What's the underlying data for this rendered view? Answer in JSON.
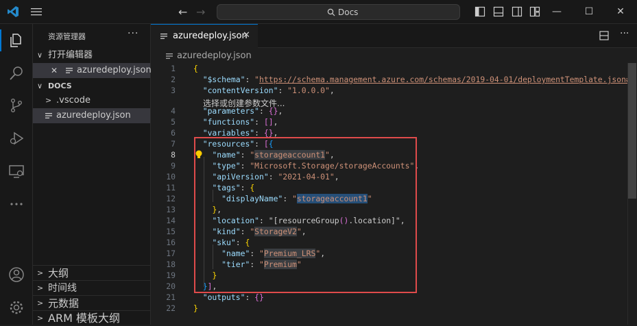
{
  "titlebar": {
    "search_text": "Docs",
    "back_icon": "arrow-left-icon",
    "forward_icon": "arrow-right-icon",
    "window_controls": [
      "minimize",
      "maximize",
      "close"
    ]
  },
  "activity_bar": {
    "icons": [
      "explorer-icon",
      "search-icon",
      "source-control-icon",
      "run-debug-icon",
      "remote-explorer-icon",
      "more-icon",
      "account-icon",
      "settings-gear-icon"
    ]
  },
  "sidebar": {
    "title": "资源管理器",
    "open_editors_label": "打开编辑器",
    "open_editor_file": "azuredeploy.json",
    "docs_label": "DOCS",
    "vscode_folder": ".vscode",
    "docs_file": "azuredeploy.json",
    "bottom_sections": [
      "大纲",
      "时间线",
      "元数据",
      "ARM 模板大纲"
    ]
  },
  "tabs": [
    {
      "label": "azuredeploy.json",
      "active": true
    }
  ],
  "breadcrumb": "azuredeploy.json",
  "editor": {
    "hint_text": "选择或创建参数文件...",
    "current_line": 8,
    "lines": [
      "{",
      "  \"$schema\": \"https://schema.management.azure.com/schemas/2019-04-01/deploymentTemplate.json#\",",
      "  \"contentVersion\": \"1.0.0.0\",",
      "  \"parameters\": {},",
      "  \"functions\": [],",
      "  \"variables\": {},",
      "  \"resources\": [{",
      "    \"name\": \"storageaccount1\",",
      "    \"type\": \"Microsoft.Storage/storageAccounts\",",
      "    \"apiVersion\": \"2021-04-01\",",
      "    \"tags\": {",
      "      \"displayName\": \"storageaccount1\"",
      "    },",
      "    \"location\": \"[resourceGroup().location]\",",
      "    \"kind\": \"StorageV2\",",
      "    \"sku\": {",
      "      \"name\": \"Premium_LRS\",",
      "      \"tier\": \"Premium\"",
      "    }",
      "  }],",
      "  \"outputs\": {}",
      "}"
    ]
  },
  "colors": {
    "accent": "#0078d4",
    "highlight_box": "#e04b4b",
    "key": "#9cdcfe",
    "string": "#ce9178"
  }
}
